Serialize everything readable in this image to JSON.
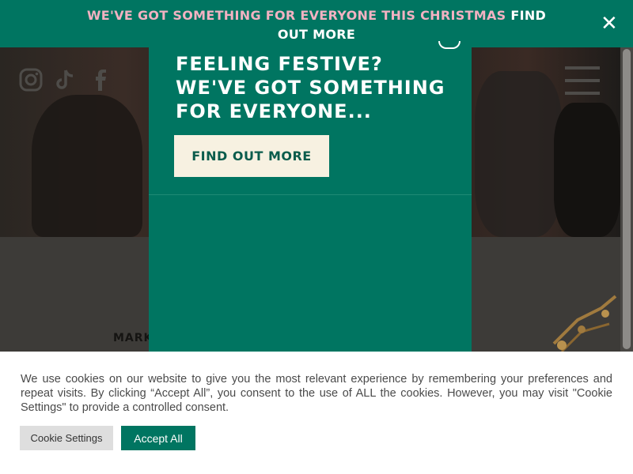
{
  "banner": {
    "pink_text": "WE'VE GOT SOMETHING FOR EVERYONE THIS CHRISTMAS",
    "link_text": "FIND OUT MORE",
    "close_glyph": "✕"
  },
  "modal": {
    "title": "FEELING FESTIVE? WE'VE GOT SOMETHING FOR EVERYONE...",
    "button_label": "FIND OUT MORE"
  },
  "page": {
    "marker_text": "MARK"
  },
  "social": {
    "icons": [
      "instagram-icon",
      "tiktok-icon",
      "facebook-icon"
    ]
  },
  "cookie": {
    "text": "We use cookies on our website to give you the most relevant experience by remembering your preferences and repeat visits. By clicking “Accept All”, you consent to the use of ALL the cookies. However, you may visit \"Cookie Settings\" to provide a controlled consent.",
    "settings_label": "Cookie Settings",
    "accept_label": "Accept All"
  },
  "colors": {
    "brand_green": "#007561",
    "banner_pink": "#f2b2c2",
    "button_cream": "#f7f1e1"
  }
}
